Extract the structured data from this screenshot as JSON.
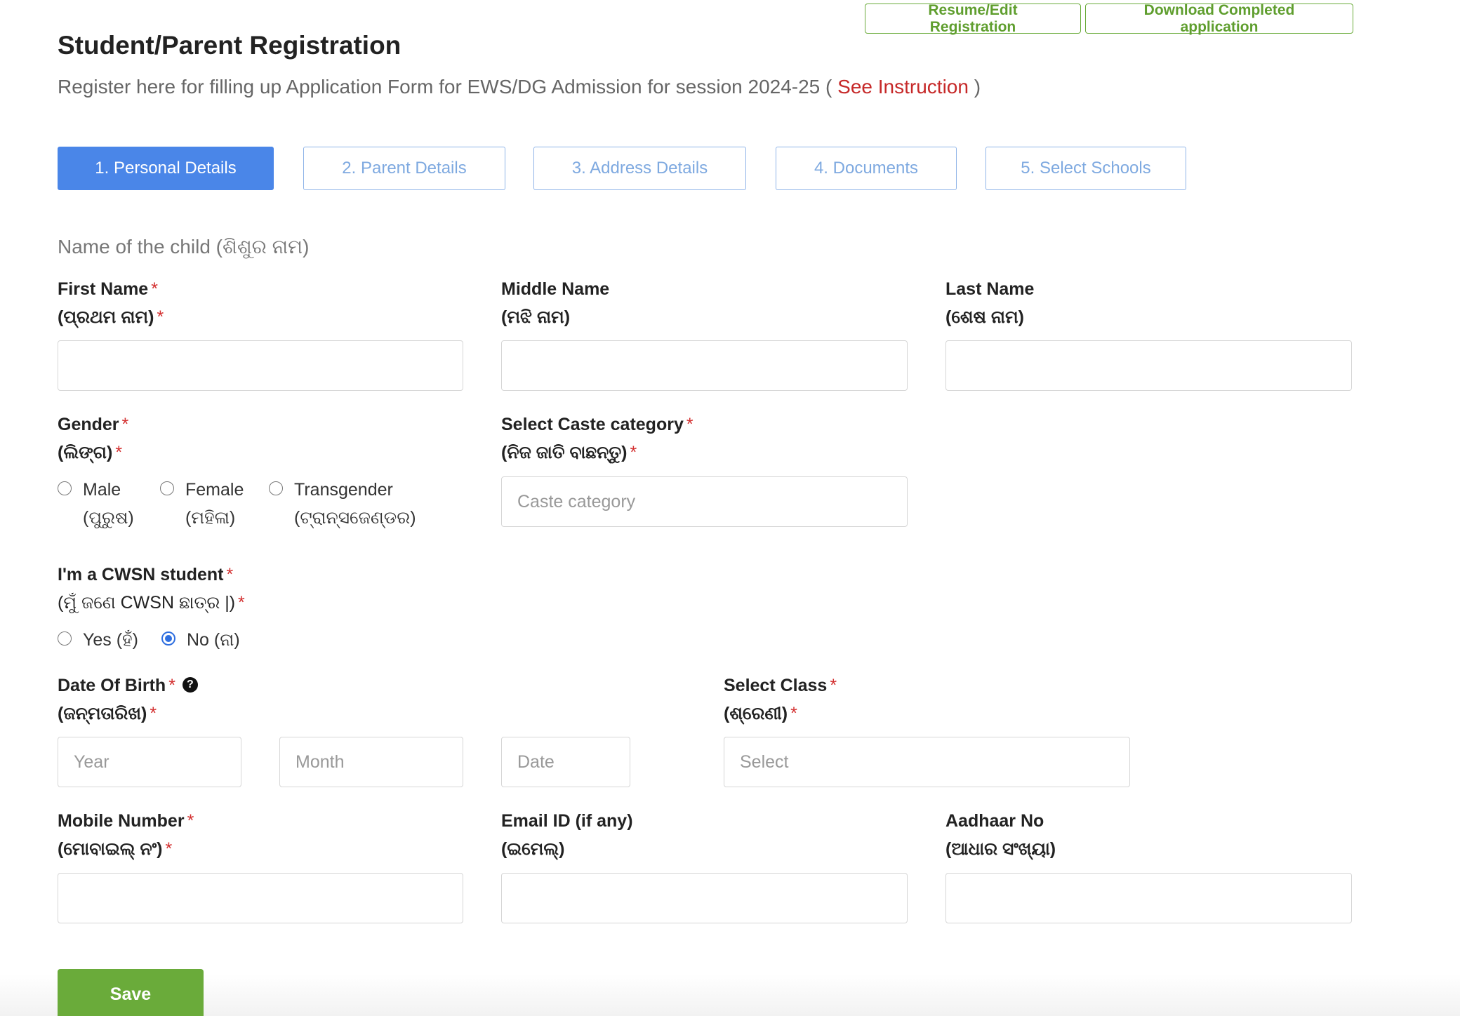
{
  "top_actions": {
    "resume_label": "Resume/Edit Registration",
    "download_label": "Download Completed application"
  },
  "header": {
    "title": "Student/Parent Registration",
    "subtitle_prefix": "Register here for filling up Application Form for EWS/DG Admission for session 2024-25 (",
    "subtitle_link": "See Instruction",
    "subtitle_suffix": ")"
  },
  "tabs": [
    {
      "label": "1. Personal Details",
      "active": true
    },
    {
      "label": "2. Parent Details",
      "active": false
    },
    {
      "label": "3. Address Details",
      "active": false
    },
    {
      "label": "4. Documents",
      "active": false
    },
    {
      "label": "5. Select Schools",
      "active": false
    }
  ],
  "form": {
    "section_label": "Name of the child (ଶିଶୁର ନାମ)",
    "first_name": {
      "label": "First Name",
      "sub": "(ପ୍ରଥମ ନାମ)",
      "required": "*",
      "value": ""
    },
    "middle_name": {
      "label": "Middle Name",
      "sub": "(ମଝି ନାମ)",
      "value": ""
    },
    "last_name": {
      "label": "Last Name",
      "sub": "(ଶେଷ ନାମ)",
      "value": ""
    },
    "gender": {
      "label": "Gender",
      "sub": "(ଲିଙ୍ଗ)",
      "required": "*",
      "options": [
        {
          "label": "Male",
          "sub": "(ପୁରୁଷ)",
          "checked": false
        },
        {
          "label": "Female",
          "sub": "(ମହିଳା)",
          "checked": false
        },
        {
          "label": "Transgender",
          "sub": "(ଟ୍ରାନ୍ସଜେଣ୍ଡର)",
          "checked": false
        }
      ]
    },
    "caste": {
      "label": "Select Caste category",
      "sub": "(ନିଜ ଜାତି ବାଛନ୍ତୁ)",
      "required": "*",
      "placeholder": "Caste category"
    },
    "cwsn": {
      "label": "I'm a CWSN student",
      "sub": "(ମୁଁ ଜଣେ CWSN ଛାତ୍ର |)",
      "required": "*",
      "options": [
        {
          "label": "Yes (ହଁ)",
          "checked": false
        },
        {
          "label": "No (ନା)",
          "checked": true
        }
      ]
    },
    "dob": {
      "label": "Date Of Birth",
      "sub": "(ଜନ୍ମତାରିଖ)",
      "required": "*",
      "help_icon": "question-circle-icon",
      "year_placeholder": "Year",
      "month_placeholder": "Month",
      "date_placeholder": "Date"
    },
    "class": {
      "label": "Select Class",
      "sub": "(ଶ୍ରେଣୀ)",
      "required": "*",
      "placeholder": "Select"
    },
    "mobile": {
      "label": "Mobile Number",
      "sub": "(ମୋବାଇଲ୍ ନଂ)",
      "required": "*",
      "value": ""
    },
    "email": {
      "label": "Email ID (if any)",
      "sub": "(ଇମେଲ୍)",
      "value": ""
    },
    "aadhaar": {
      "label": "Aadhaar No",
      "sub": "(ଆଧାର ସଂଖ୍ୟା)",
      "value": ""
    },
    "save_label": "Save"
  },
  "colors": {
    "primary": "#4a86e8",
    "green": "#6aab3a",
    "required": "#d32f2f",
    "link": "#c62828"
  }
}
